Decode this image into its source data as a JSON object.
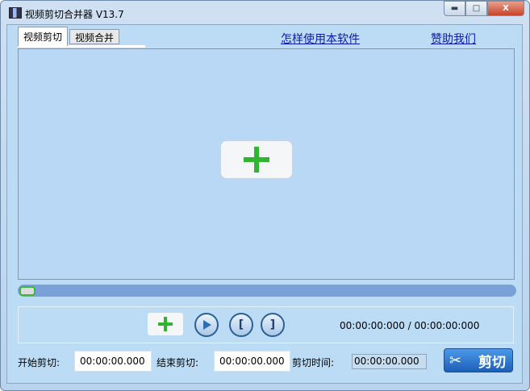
{
  "window": {
    "title": "视频剪切合并器 V13.7"
  },
  "tabs": [
    {
      "label": "视频剪切"
    },
    {
      "label": "视频合并"
    }
  ],
  "links": {
    "howto": "怎样使用本软件",
    "donate": "赞助我们"
  },
  "player": {
    "time_display": "00:00:00:000 / 00:00:00:000",
    "progress": 0
  },
  "controls": {
    "start_label": "开始剪切:",
    "start_value": "00:00:00.000",
    "end_label": "结束剪切:",
    "end_value": "00:00:00.000",
    "duration_label": "剪切时间:",
    "duration_value": "00:00:00.000",
    "cut_label": "剪切"
  },
  "colors": {
    "accent": "#1c5fb8",
    "plus": "#2fb52f"
  }
}
